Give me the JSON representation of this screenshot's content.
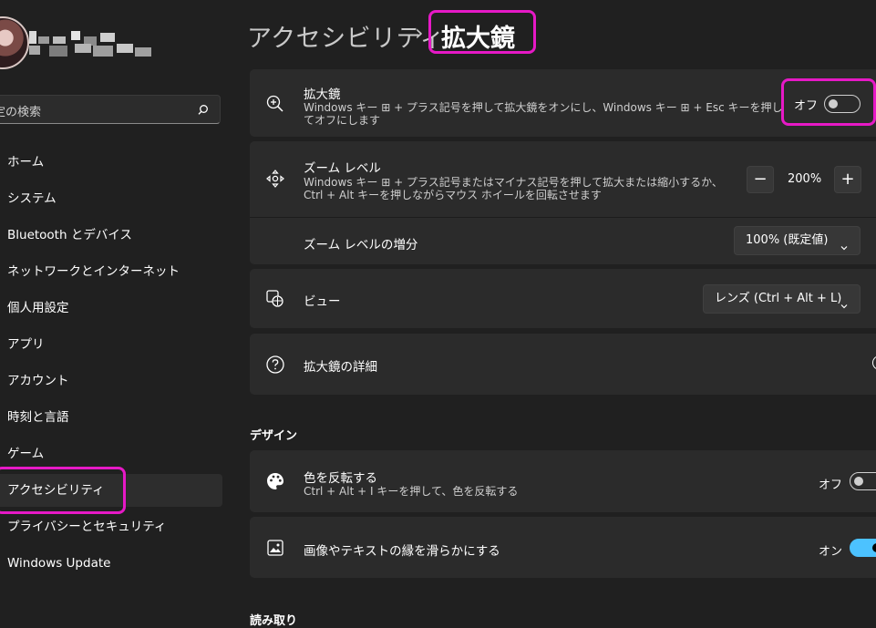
{
  "sidebar": {
    "search_placeholder": "定の検索",
    "items": [
      {
        "label": "ホーム"
      },
      {
        "label": "システム"
      },
      {
        "label": "Bluetooth とデバイス"
      },
      {
        "label": "ネットワークとインターネット"
      },
      {
        "label": "個人用設定"
      },
      {
        "label": "アプリ"
      },
      {
        "label": "アカウント"
      },
      {
        "label": "時刻と言語"
      },
      {
        "label": "ゲーム"
      },
      {
        "label": "アクセシビリティ",
        "selected": true
      },
      {
        "label": "プライバシーとセキュリティ"
      },
      {
        "label": "Windows Update"
      }
    ]
  },
  "header": {
    "parent": "アクセシビリティ",
    "separator": "›",
    "current": "拡大鏡"
  },
  "magnifier": {
    "title": "拡大鏡",
    "desc_line1": "Windows キー ⊞ + プラス記号を押して拡大鏡をオンにし、Windows キー ⊞ + Esc キーを押し",
    "desc_line2": "てオフにします",
    "toggle_label": "オフ",
    "toggle_on": false,
    "icon": "zoom-in-icon"
  },
  "zoom": {
    "title": "ズーム レベル",
    "desc_line1": "Windows キー ⊞ + プラス記号またはマイナス記号を押して拡大または縮小するか、",
    "desc_line2": "Ctrl + Alt キーを押しながらマウス ホイールを回転させます",
    "decrease": "−",
    "value": "200%",
    "increase": "+",
    "icon": "move-arrows-icon"
  },
  "increment": {
    "title": "ズーム レベルの増分",
    "selected": "100% (既定値)"
  },
  "view": {
    "title": "ビュー",
    "selected": "レンズ (Ctrl + Alt + L)",
    "icon": "view-mode-icon"
  },
  "details": {
    "title": "拡大鏡の詳細",
    "icon": "help-icon"
  },
  "design_section": "デザイン",
  "invert": {
    "title": "色を反転する",
    "desc": "Ctrl + Alt + I キーを押して、色を反転する",
    "toggle_label": "オフ",
    "toggle_on": false,
    "icon": "palette-icon"
  },
  "smooth": {
    "title": "画像やテキストの縁を滑らかにする",
    "toggle_label": "オン",
    "toggle_on": true,
    "icon": "image-smooth-icon"
  },
  "reading_section": "読み取り",
  "colors": {
    "accent": "#4cc2ff",
    "highlight": "#e619c6",
    "background": "#202020",
    "card": "#2b2b2b"
  }
}
